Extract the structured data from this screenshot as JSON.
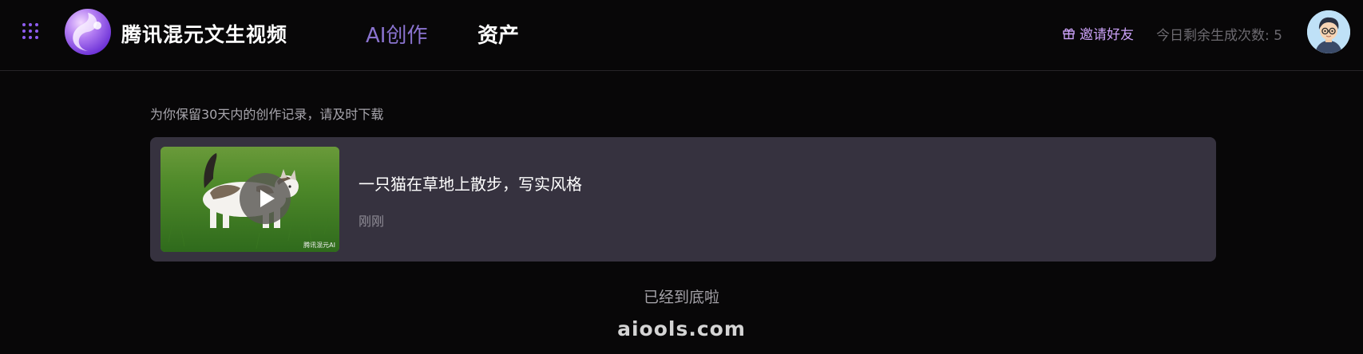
{
  "header": {
    "brand": "腾讯混元文生视频",
    "nav": {
      "ai_create": "AI创作",
      "assets": "资产"
    },
    "invite_label": "邀请好友",
    "remaining": "今日剩余生成次数: 5"
  },
  "main": {
    "notice": "为你保留30天内的创作记录，请及时下载",
    "records": [
      {
        "prompt": "一只猫在草地上散步，写实风格",
        "time": "刚刚",
        "watermark": "腾讯混元AI"
      }
    ],
    "end_text": "已经到底啦"
  },
  "site": "aiools.com",
  "colors": {
    "background": "#080708",
    "card": "#36323f",
    "accent": "#8a73cf",
    "invite": "#c9a0f5"
  },
  "icons": {
    "apps": "apps-grid-icon",
    "invite": "gift-icon",
    "play": "play-icon"
  }
}
